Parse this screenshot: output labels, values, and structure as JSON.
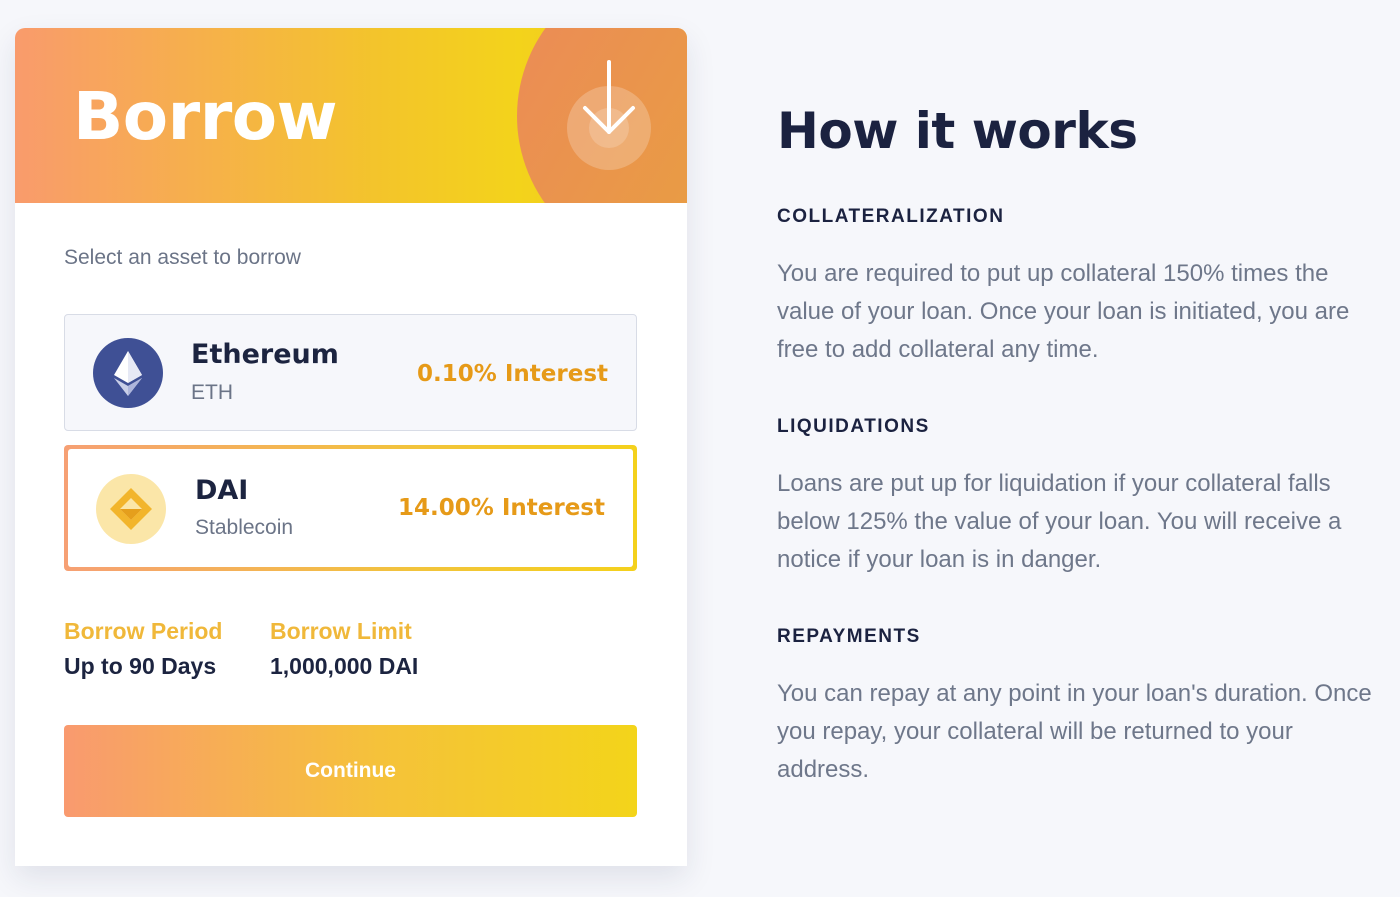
{
  "borrow_card": {
    "title": "Borrow",
    "select_label": "Select an asset to borrow",
    "assets": [
      {
        "name": "Ethereum",
        "symbol": "ETH",
        "rate": "0.10% Interest",
        "icon": "ethereum-icon",
        "selected": false
      },
      {
        "name": "DAI",
        "symbol": "Stablecoin",
        "rate": "14.00% Interest",
        "icon": "dai-icon",
        "selected": true
      }
    ],
    "stats": [
      {
        "label": "Borrow Period",
        "value": "Up to 90 Days"
      },
      {
        "label": "Borrow Limit",
        "value": "1,000,000 DAI"
      }
    ],
    "continue_label": "Continue",
    "header_icon": "download-arrow-icon"
  },
  "how_it_works": {
    "title": "How it works",
    "sections": [
      {
        "heading": "COLLATERALIZATION",
        "body": "You are required to put up collateral 150% times the value of your loan. Once your loan is initiated, you are free to add collateral any time."
      },
      {
        "heading": "LIQUIDATIONS",
        "body": "Loans are put up for liquidation if your collateral falls below 125% the value of your loan. You will receive a notice if your loan is in danger."
      },
      {
        "heading": "REPAYMENTS",
        "body": "You can repay at any point in your loan's duration. Once you repay, your collateral will be returned to your address."
      }
    ]
  },
  "colors": {
    "accent_orange": "#f99b6c",
    "accent_yellow": "#f3d31b",
    "rate_text": "#e69a18",
    "stat_label": "#f0b83a",
    "heading_text": "#1b2240",
    "body_text": "#6e778a",
    "eth_coin": "#3f5095",
    "dai_coin": "#fbe6a8"
  }
}
